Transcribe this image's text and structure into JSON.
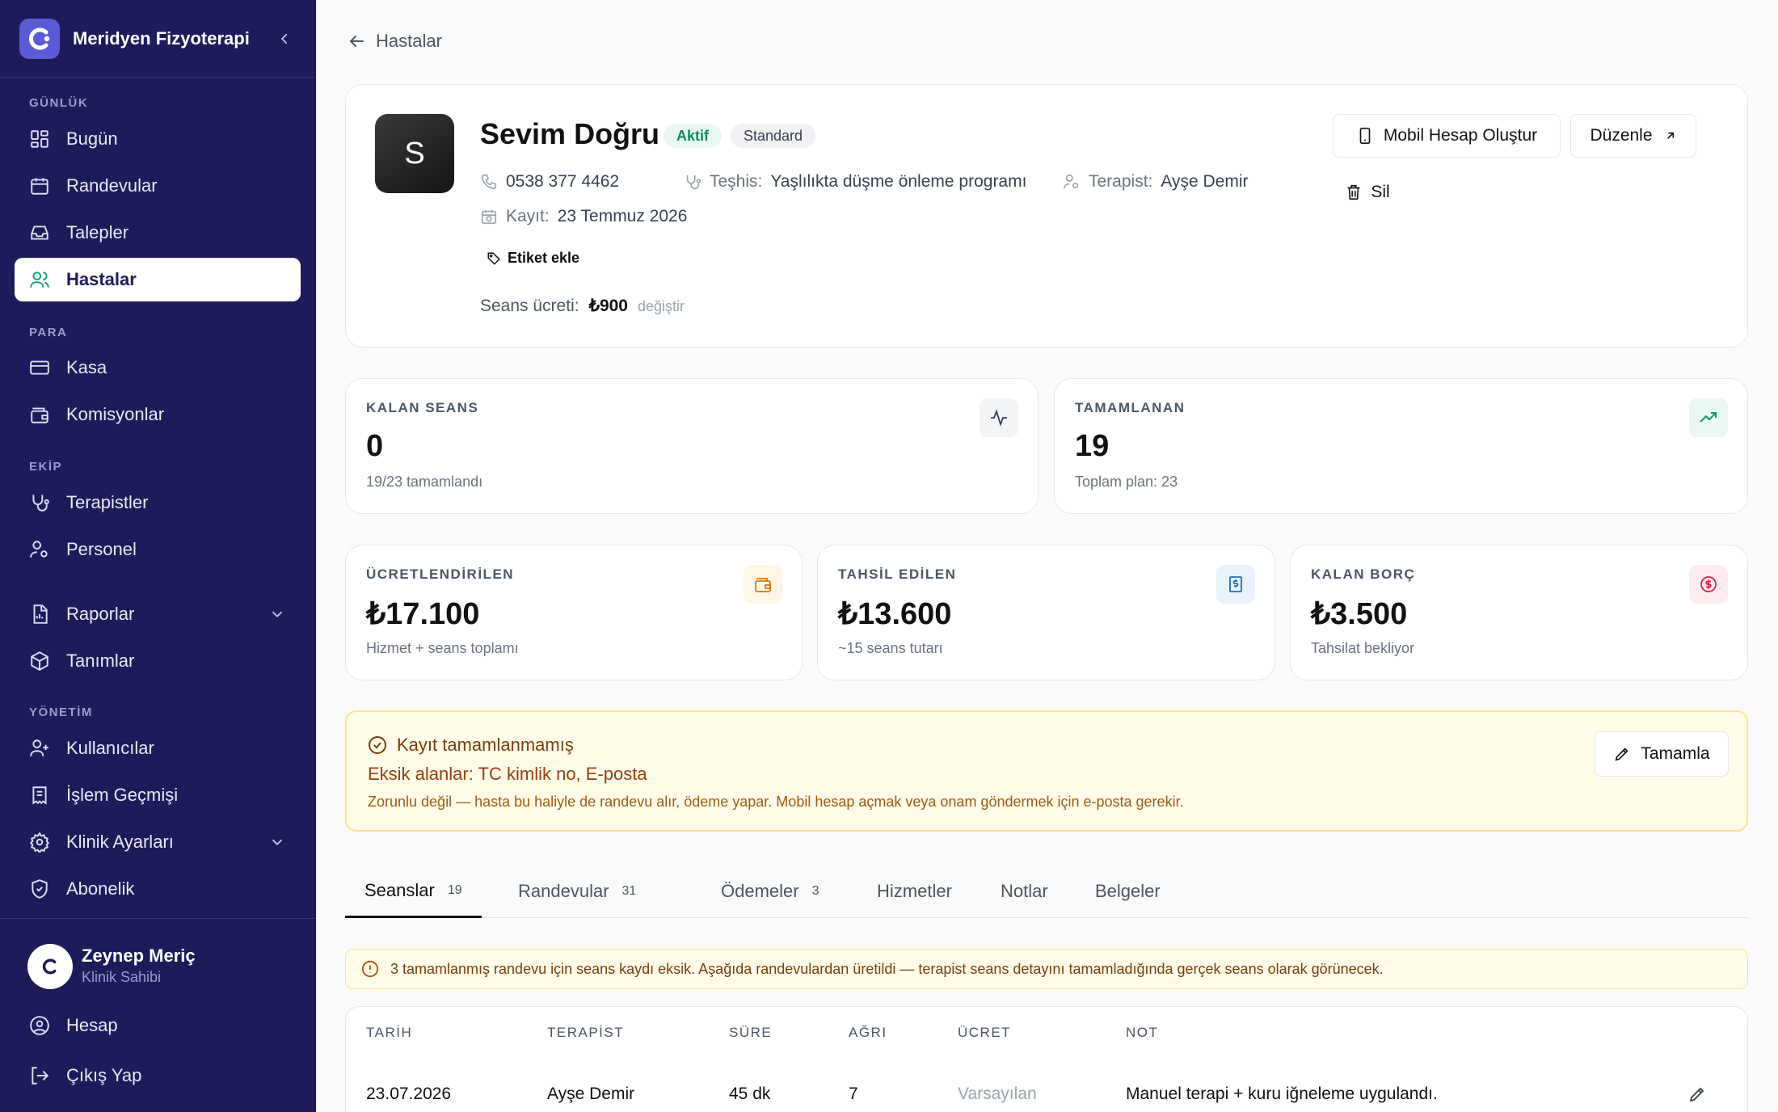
{
  "sidebar": {
    "brand": "Meridyen Fizyoterapi",
    "sections": {
      "daily": "GÜNLÜK",
      "money": "PARA",
      "team": "EKİP",
      "admin": "YÖNETİM"
    },
    "items": {
      "today": "Bugün",
      "appointments": "Randevular",
      "requests": "Talepler",
      "patients": "Hastalar",
      "cash": "Kasa",
      "commissions": "Komisyonlar",
      "therapists": "Terapistler",
      "staff": "Personel",
      "reports": "Raporlar",
      "definitions": "Tanımlar",
      "users": "Kullanıcılar",
      "history": "İşlem Geçmişi",
      "clinic_settings": "Klinik Ayarları",
      "subscription": "Abonelik"
    },
    "user": {
      "name": "Zeynep Meriç",
      "role": "Klinik Sahibi"
    },
    "account": "Hesap",
    "logout": "Çıkış Yap"
  },
  "breadcrumb": {
    "back_label": "Hastalar"
  },
  "patient": {
    "initial": "S",
    "name": "Sevim Doğru",
    "status": "Aktif",
    "plan": "Standard",
    "phone": "0538 377 4462",
    "diagnosis_label": "Teşhis:",
    "diagnosis": "Yaşlılıkta düşme önleme programı",
    "therapist_label": "Terapist:",
    "therapist": "Ayşe Demir",
    "registered_label": "Kayıt:",
    "registered": "23 Temmuz 2026",
    "add_tag": "Etiket ekle",
    "fee_label": "Seans ücreti:",
    "fee": "₺900",
    "fee_change": "değiştir"
  },
  "actions": {
    "mobile": "Mobil Hesap Oluştur",
    "edit": "Düzenle",
    "delete": "Sil"
  },
  "stats": {
    "remaining": {
      "label": "KALAN SEANS",
      "value": "0",
      "sub": "19/23 tamamlandı"
    },
    "completed": {
      "label": "TAMAMLANAN",
      "value": "19",
      "sub": "Toplam plan: 23"
    },
    "billed": {
      "label": "ÜCRETLENDİRİLEN",
      "value": "₺17.100",
      "sub": "Hizmet + seans toplamı"
    },
    "collected": {
      "label": "TAHSİL EDİLEN",
      "value": "₺13.600",
      "sub": "~15 seans tutarı"
    },
    "debt": {
      "label": "KALAN BORÇ",
      "value": "₺3.500",
      "sub": "Tahsilat bekliyor"
    }
  },
  "warning": {
    "title": "Kayıt tamamlanmamış",
    "missing": "Eksik alanlar: TC kimlik no, E-posta",
    "note": "Zorunlu değil — hasta bu haliyle de randevu alır, ödeme yapar. Mobil hesap açmak veya onam göndermek için e-posta gerekir.",
    "button": "Tamamla"
  },
  "tabs": [
    {
      "label": "Seanslar",
      "count": "19"
    },
    {
      "label": "Randevular",
      "count": "31"
    },
    {
      "label": "Ödemeler",
      "count": "3"
    },
    {
      "label": "Hizmetler",
      "count": ""
    },
    {
      "label": "Notlar",
      "count": ""
    },
    {
      "label": "Belgeler",
      "count": ""
    }
  ],
  "notice": "3 tamamlanmış randevu için seans kaydı eksik. Aşağıda randevulardan üretildi — terapist seans detayını tamamladığında gerçek seans olarak görünecek.",
  "table": {
    "headers": [
      "TARİH",
      "TERAPİST",
      "SÜRE",
      "AĞRI",
      "ÜCRET",
      "NOT"
    ],
    "rows": [
      {
        "date": "23.07.2026",
        "therapist": "Ayşe Demir",
        "duration": "45 dk",
        "pain": "7",
        "fee": "Varsayılan",
        "note": "Manuel terapi + kuru iğneleme uygulandı."
      }
    ]
  },
  "colors": {
    "sidebar": "#1e1b5b",
    "accent": "#10a37f",
    "warning_bg": "#fefbe8",
    "warning_border": "#fbe48c"
  }
}
